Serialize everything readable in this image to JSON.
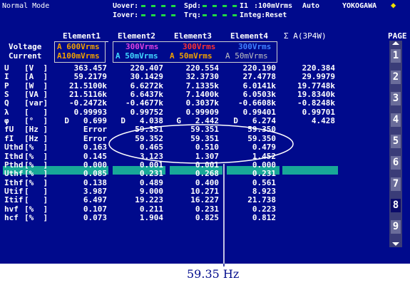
{
  "header": {
    "mode": "Normal Mode",
    "uover_label": "Uover:",
    "iover_label": "Iover:",
    "spd_label": "Spd:",
    "trq_label": "Trq:",
    "indicator_dashes": "▬ ▬ ▬ ▬",
    "i1_label": "I1",
    "i1_value": ":100mVrms",
    "auto": "Auto",
    "integ": "Integ:Reset",
    "brand": "YOKOGAWA",
    "brand_mark": "◆"
  },
  "columns": {
    "element1": "Element1",
    "element2": "Element2",
    "element3": "Element3",
    "element4": "Element4",
    "sigma": "Σ A(3P4W)"
  },
  "range_rows": {
    "voltage_label": "Voltage",
    "current_label": "Current",
    "e1_v": "A 600Vrms",
    "e1_i": "A100mVrms",
    "e2_v": "300Vrms",
    "e2_i": "A 50mVrms",
    "e3_v": "300Vrms",
    "e3_i": "A 50mVrms",
    "e4_v": "300Vrms",
    "e4_i": "A 50mVrms"
  },
  "rows": [
    {
      "sym": "U",
      "unit": "[V  ]",
      "v1": "363.457",
      "v2": "220.407",
      "v3": "220.554",
      "v4": "220.190",
      "vs": "220.384"
    },
    {
      "sym": "I",
      "unit": "[A  ]",
      "v1": "59.2179",
      "v2": "30.1429",
      "v3": "32.3730",
      "v4": "27.4778",
      "vs": "29.9979"
    },
    {
      "sym": "P",
      "unit": "[W  ]",
      "v1": "21.5100k",
      "v2": "6.6272k",
      "v3": "7.1335k",
      "v4": "6.0141k",
      "vs": "19.7748k"
    },
    {
      "sym": "S",
      "unit": "[VA ]",
      "v1": "21.5116k",
      "v2": "6.6437k",
      "v3": "7.1400k",
      "v4": "6.0503k",
      "vs": "19.8340k"
    },
    {
      "sym": "Q",
      "unit": "[var]",
      "v1": "-0.2472k",
      "v2": "-0.4677k",
      "v3": "0.3037k",
      "v4": "-0.6608k",
      "vs": "-0.8248k"
    },
    {
      "sym": "λ",
      "unit": "[   ]",
      "v1": "0.99993",
      "v2": "0.99752",
      "v3": "0.99909",
      "v4": "0.99401",
      "vs": "0.99701"
    },
    {
      "sym": "φ",
      "unit": "[°  ]",
      "v1": "D   0.699",
      "v2": "D   4.038",
      "v3": "G   2.442",
      "v4": "D   6.274",
      "vs": "4.428"
    },
    {
      "sym": "fU",
      "unit": "[Hz ]",
      "v1": "Error",
      "v2": "59.351",
      "v3": "59.351",
      "v4": "59.350",
      "vs": ""
    },
    {
      "sym": "fI",
      "unit": "[Hz ]",
      "v1": "Error",
      "v2": "59.352",
      "v3": "59.351",
      "v4": "59.350",
      "vs": ""
    },
    {
      "sym": "Uthd",
      "unit": "[%  ]",
      "v1": "0.163",
      "v2": "0.465",
      "v3": "0.510",
      "v4": "0.479",
      "vs": ""
    },
    {
      "sym": "Ithd",
      "unit": "[%  ]",
      "v1": "0.145",
      "v2": "3.123",
      "v3": "1.307",
      "v4": "1.452",
      "vs": ""
    },
    {
      "sym": "Pthd",
      "unit": "[%  ]",
      "v1": "0.000",
      "v2": "0.001",
      "v3": "0.001",
      "v4": "0.000",
      "vs": ""
    },
    {
      "sym": "Uthf",
      "unit": "[%  ]",
      "v1": "0.085",
      "v2": "0.231",
      "v3": "0.268",
      "v4": "0.231",
      "vs": ""
    },
    {
      "sym": "Ithf",
      "unit": "[%  ]",
      "v1": "0.138",
      "v2": "0.489",
      "v3": "0.400",
      "v4": "0.561",
      "vs": ""
    },
    {
      "sym": "Utif",
      "unit": "[   ]",
      "v1": "3.987",
      "v2": "9.000",
      "v3": "10.271",
      "v4": "8.923",
      "vs": ""
    },
    {
      "sym": "Itif",
      "unit": "[   ]",
      "v1": "6.497",
      "v2": "19.223",
      "v3": "16.227",
      "v4": "21.738",
      "vs": ""
    },
    {
      "sym": "hvf",
      "unit": "[%  ]",
      "v1": "0.107",
      "v2": "0.211",
      "v3": "0.231",
      "v4": "0.223",
      "vs": ""
    },
    {
      "sym": "hcf",
      "unit": "[%  ]",
      "v1": "0.073",
      "v2": "1.904",
      "v3": "0.825",
      "v4": "0.812",
      "vs": ""
    }
  ],
  "page": {
    "label": "PAGE",
    "numbers": [
      "1",
      "2",
      "3",
      "4",
      "5",
      "6",
      "7",
      "8",
      "9"
    ],
    "active": "8"
  },
  "annotation": {
    "text": "59.35 Hz"
  },
  "colors": {
    "screen_bg": "#000a8c",
    "highlight": "#18a898",
    "indicator": "#22e040",
    "range_orange": "#f0a000",
    "range_cyan": "#40d8ff",
    "range_magenta": "#e040e0",
    "range_red": "#ff3030",
    "range_blue": "#4080ff"
  }
}
